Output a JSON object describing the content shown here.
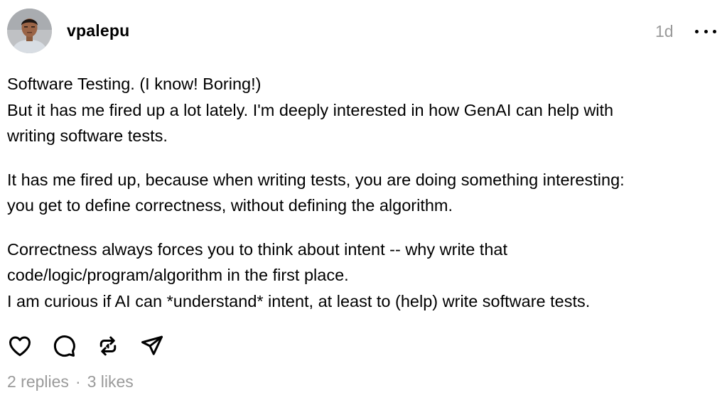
{
  "post": {
    "author": "vpalepu",
    "time": "1d",
    "paragraphs": [
      {
        "lines": [
          "Software Testing. (I know! Boring!)",
          "But it has me fired up a lot lately. I'm deeply interested in how GenAI can help with",
          "writing software tests."
        ]
      },
      {
        "lines": [
          "It has me fired up, because when writing tests, you are doing something interesting:",
          "you get to define correctness, without defining the algorithm."
        ]
      },
      {
        "lines": [
          "Correctness always forces you to think about intent -- why write that",
          "code/logic/program/algorithm in the first place.",
          "I am curious if AI can *understand* intent, at least to (help) write software tests."
        ]
      }
    ],
    "actions": [
      {
        "icon": "heart-icon"
      },
      {
        "icon": "comment-icon"
      },
      {
        "icon": "repost-icon"
      },
      {
        "icon": "share-icon"
      }
    ],
    "stats": {
      "replies": "2 replies",
      "separator": "·",
      "likes": "3 likes"
    }
  },
  "colors": {
    "text": "#000000",
    "muted": "#9a9a9a",
    "background": "#ffffff"
  }
}
